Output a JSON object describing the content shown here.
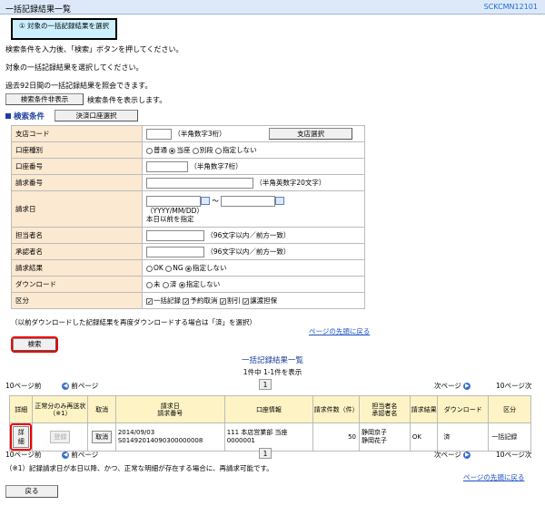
{
  "header": {
    "title": "一括記録結果一覧",
    "code": "SCKCMN12101"
  },
  "step": {
    "label": "① 対象の一括記録結果を選択"
  },
  "intro": {
    "line1": "検索条件を入力後、「検索」ボタンを押してください。",
    "line2": "対象の一括記録結果を選択してください。",
    "line3": "過去92日間の一括記録結果を照会できます。"
  },
  "toggle": {
    "button": "検索条件非表示",
    "text": "検索条件を表示します。"
  },
  "search": {
    "section_title": "検索条件",
    "account_select_button": "決済口座選択",
    "branch_code": {
      "label": "支店コード",
      "value": "",
      "hint": "（半角数字3桁）",
      "button": "支店選択"
    },
    "account_type": {
      "label": "口座種別",
      "options": [
        "普通",
        "当座",
        "別段",
        "指定しない"
      ],
      "selected": "当座"
    },
    "account_number": {
      "label": "口座番号",
      "value": "",
      "hint": "（半角数字7桁）"
    },
    "request_number": {
      "label": "請求番号",
      "value": "",
      "hint": "（半角英数字20文字）"
    },
    "request_date": {
      "label": "請求日",
      "from": "",
      "to": "",
      "sep": "～",
      "format": "（YYYY/MM/DD）",
      "note": "本日以前を指定"
    },
    "person": {
      "label": "担当者名",
      "value": "",
      "hint": "（96文字以内／前方一致）"
    },
    "approver": {
      "label": "承認者名",
      "value": "",
      "hint": "（96文字以内／前方一致）"
    },
    "result": {
      "label": "請求結果",
      "options": [
        "OK",
        "NG",
        "指定しない"
      ],
      "selected": "指定しない"
    },
    "download": {
      "label": "ダウンロード",
      "options": [
        "未",
        "済",
        "指定しない"
      ],
      "selected": "指定しない"
    },
    "category": {
      "label": "区分",
      "options": [
        "一括記録",
        "予約取消",
        "割引",
        "譲渡担保"
      ],
      "checked": [
        true,
        true,
        true,
        true
      ]
    },
    "footnote": "（以前ダウンロードした記録結果を再度ダウンロードする場合は「済」を選択）",
    "page_top": "ページの先頭に戻る",
    "search_button": "検索"
  },
  "results": {
    "title": "一括記録結果一覧",
    "count": "1件中 1-1件を表示",
    "prev10": "10ページ前",
    "prev": "前ページ",
    "page": "1",
    "next": "次ページ",
    "next10": "10ページ次",
    "headers": [
      "詳細",
      "正常分のみ再送状（※1）",
      "取消",
      "請求日\n請求番号",
      "口座情報",
      "請求件数（件）",
      "担当者名\n承認者名",
      "請求結果",
      "ダウンロード",
      "区分"
    ],
    "rows": [
      {
        "detail": "詳細",
        "resend": "登録",
        "cancel": "取消",
        "date": "2014/09/03",
        "number": "S01492014090300000008",
        "account1": "111 本店営業部 当座",
        "account2": "0000001",
        "count": "50",
        "person": "静岡京子",
        "approver": "静岡花子",
        "result": "OK",
        "download": "済",
        "category": "一括記録"
      }
    ],
    "footnote": "（※1）記録請求日が本日以降、かつ、正常な明細が存在する場合に、再請求可能です。",
    "page_top": "ページの先頭に戻る"
  },
  "back_button": "戻る",
  "colors": {
    "header_bg": "#dde9f9",
    "label_bg": "#fce9d2",
    "table_header_bg": "#fdf3c5",
    "highlight": "#e00000",
    "link": "#1b4fc4"
  }
}
